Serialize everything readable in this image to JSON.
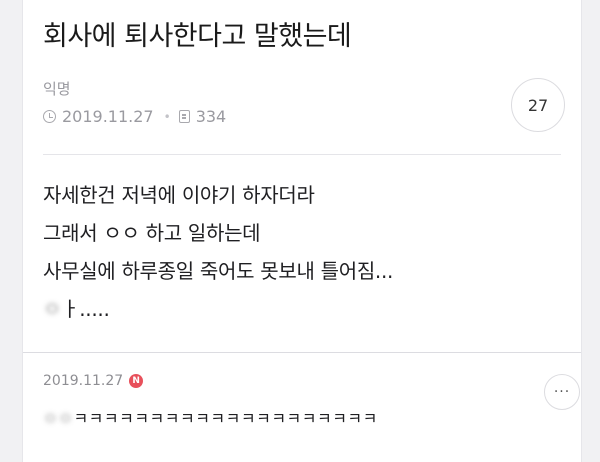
{
  "post": {
    "title": "회사에 퇴사한다고 말했는데",
    "author": "익명",
    "date": "2019.11.27",
    "views": "334",
    "comment_count": "27",
    "body_lines": [
      "자세한건 저녁에 이야기 하자더라",
      "그래서 ㅇㅇ 하고 일하는데",
      "사무실에 하루종일 죽어도 못보내 틀어짐...",
      "ㅏ....."
    ]
  },
  "comment": {
    "date": "2019.11.27",
    "new_badge": "N",
    "more_label": "···",
    "text": "ㅋㅋㅋㅋㅋㅋㅋㅋㅋㅋㅋㅋㅋㅋㅋㅋㅋㅋㅋㅋ"
  },
  "icons": {
    "clock": "clock-icon",
    "document": "document-icon",
    "new": "new-badge-icon",
    "more": "more-icon"
  },
  "colors": {
    "background": "#f1f1f3",
    "card": "#ffffff",
    "meta_text": "#9a9aa0",
    "new_badge": "#e8505b"
  }
}
